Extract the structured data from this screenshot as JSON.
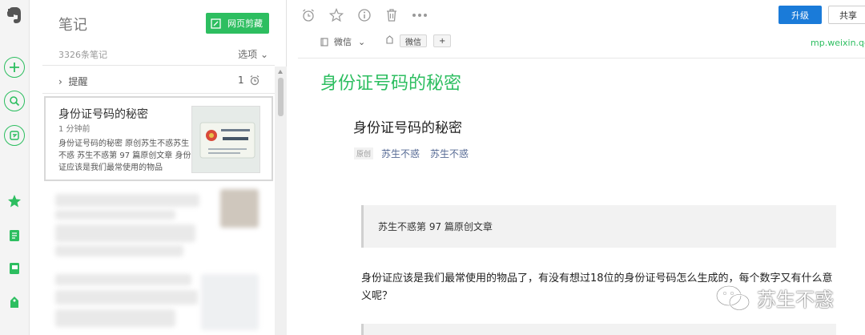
{
  "rail": {
    "icons": [
      "elephant-logo-icon",
      "new-note-icon",
      "search-icon",
      "work-chat-icon",
      "shortcuts-star-icon",
      "notes-icon",
      "notebooks-icon",
      "tags-icon"
    ]
  },
  "list": {
    "title": "笔记",
    "web_clip_label": "网页剪藏",
    "count": "3326条笔记",
    "select_label": "选项",
    "reminder_label": "提醒",
    "reminder_count": "1",
    "selected_note": {
      "title": "身份证号码的秘密",
      "time": "1 分钟前",
      "snippet": "身份证号码的秘密 原创苏生不惑苏生不惑 苏生不惑第 97 篇原创文章 身份证应该是我们最常使用的物品"
    }
  },
  "toolbar": {
    "upgrade_label": "升级",
    "share_label": "共享"
  },
  "meta": {
    "notebook": "微信",
    "tag": "微信",
    "add_tag": "+",
    "source_url": "mp.weixin.qq"
  },
  "note": {
    "title": "身份证号码的秘密",
    "article_title": "身份证号码的秘密",
    "original_badge": "原创",
    "author1": "苏生不惑",
    "author2": "苏生不惑",
    "quote": "苏生不惑第 97 篇原创文章",
    "body": "身份证应该是我们最常使用的物品了，有没有想过18位的身份证号码怎么生成的，每个数字又有什么意义呢？"
  },
  "watermark": "苏生不惑",
  "colors": {
    "accent": "#2dbe60",
    "primary_button": "#1a7bd9",
    "link": "#576b95"
  }
}
